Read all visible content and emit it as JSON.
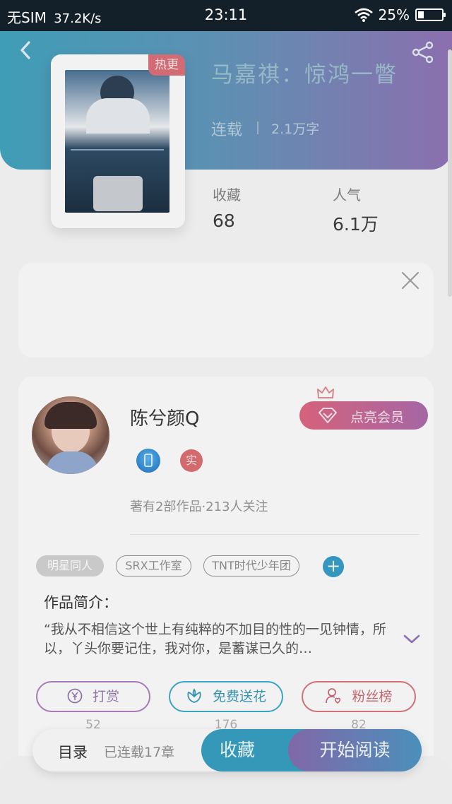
{
  "status_bar": {
    "carrier": "无SIM",
    "speed": "37.2K/s",
    "time": "23:11",
    "battery": "25%"
  },
  "book": {
    "hot_badge": "热更",
    "title": "马嘉祺：惊鸿一瞥",
    "status": "连载",
    "words": "2.1万字",
    "stats": [
      {
        "label": "收藏",
        "value": "68"
      },
      {
        "label": "人气",
        "value": "6.1万"
      }
    ]
  },
  "author": {
    "name": "陈兮颜Q",
    "badge_real": "实",
    "meta": "著有2部作品·213人关注",
    "vip_label": "点亮会员"
  },
  "tags": [
    "明星同人",
    "SRX工作室",
    "TNT时代少年团"
  ],
  "tag_add": "+",
  "intro": {
    "title": "作品简介：",
    "text": "“我从不相信这个世上有纯粹的不加目的性的一见钟情，所以，丫头你要记住，我对你，是蓄谋已久的…"
  },
  "actions": [
    {
      "label": "打赏",
      "count": "52"
    },
    {
      "label": "免费送花",
      "count": "176"
    },
    {
      "label": "粉丝榜",
      "count": "82"
    }
  ],
  "bottom_bar": {
    "toc_label": "目录",
    "toc_count": "已连载17章",
    "favorite_label": "收藏",
    "read_label": "开始阅读"
  }
}
